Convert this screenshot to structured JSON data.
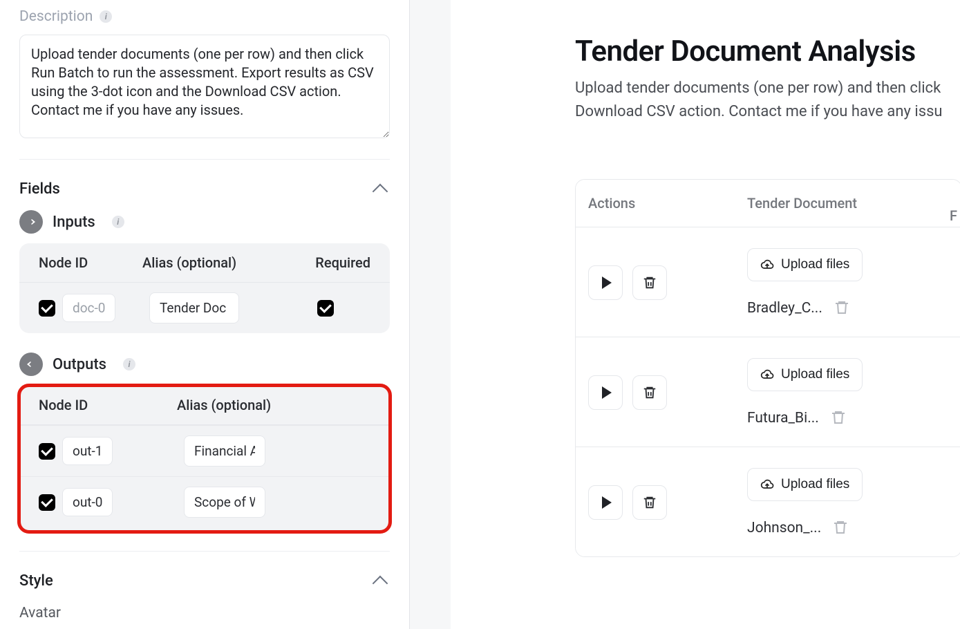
{
  "left": {
    "description_label": "Description",
    "description_value": "Upload tender documents (one per row) and then click Run Batch to run the assessment. Export results as CSV using the 3-dot icon and the Download CSV action. Contact me if you have any issues.",
    "fields_label": "Fields",
    "inputs_label": "Inputs",
    "outputs_label": "Outputs",
    "col_node_id": "Node ID",
    "col_alias": "Alias (optional)",
    "col_required": "Required",
    "inputs_rows": [
      {
        "checked": true,
        "node_id": "doc-0",
        "alias": "Tender Doc",
        "required": true
      }
    ],
    "outputs_rows": [
      {
        "checked": true,
        "node_id": "out-1",
        "alias": "Financial Ar"
      },
      {
        "checked": true,
        "node_id": "out-0",
        "alias": "Scope of W"
      }
    ],
    "style_label": "Style",
    "avatar_label": "Avatar"
  },
  "right": {
    "title": "Tender Document Analysis",
    "subtitle_line1": "Upload tender documents (one per row) and then click",
    "subtitle_line2": "Download CSV action. Contact me if you have any issu",
    "col_actions": "Actions",
    "col_tender": "Tender Document",
    "col_right_edge": "F",
    "upload_label": "Upload files",
    "rows": [
      {
        "file": "Bradley_C..."
      },
      {
        "file": "Futura_Bi..."
      },
      {
        "file": "Johnson_..."
      }
    ]
  }
}
